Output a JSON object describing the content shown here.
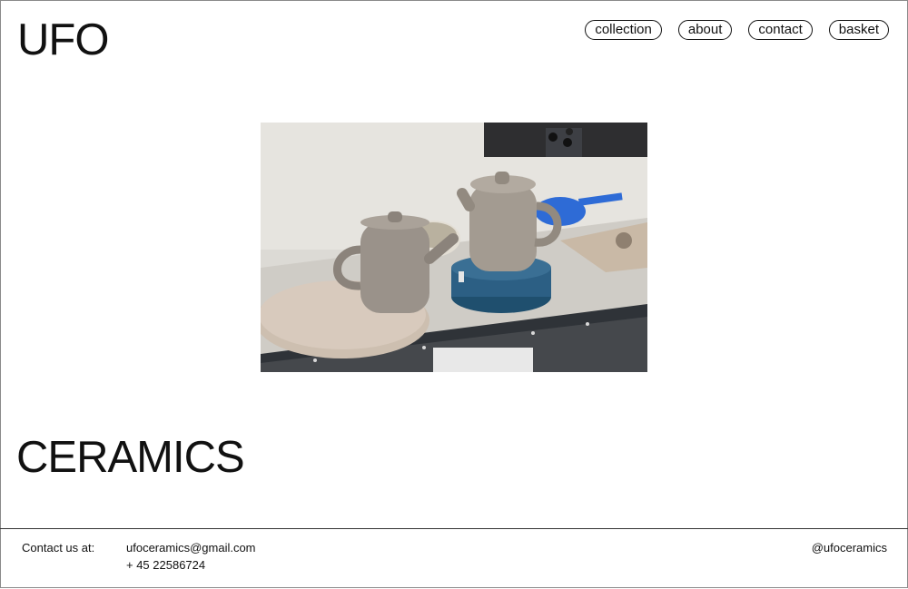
{
  "brand": {
    "name": "UFO"
  },
  "nav": {
    "items": [
      {
        "label": "collection"
      },
      {
        "label": "about"
      },
      {
        "label": "contact"
      },
      {
        "label": "basket"
      }
    ]
  },
  "hero": {
    "alt": "clay teapots on a pottery workbench"
  },
  "headline": "CERAMICS",
  "footer": {
    "contact_label": "Contact us at:",
    "email": "ufoceramics@gmail.com",
    "phone": "+ 45 22586724",
    "social": "@ufoceramics"
  }
}
